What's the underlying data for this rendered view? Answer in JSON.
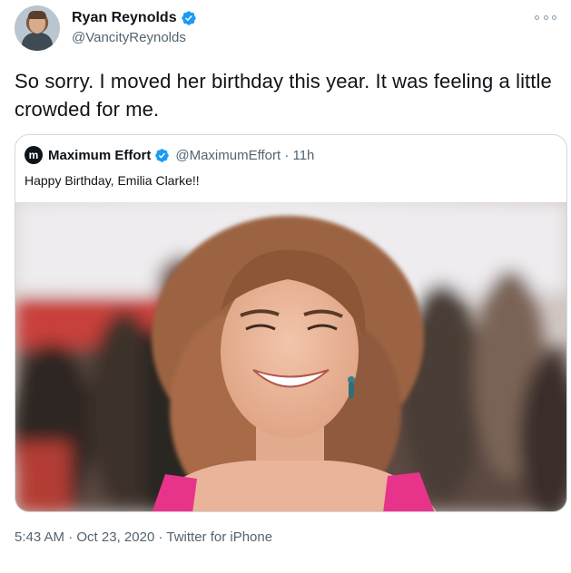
{
  "author": {
    "display_name": "Ryan Reynolds",
    "handle": "@VancityReynolds",
    "verified": true
  },
  "tweet": {
    "text": "So sorry. I moved her birthday this year. It was feeling a little crowded for me."
  },
  "quoted_tweet": {
    "logo_glyph": "m",
    "display_name": "Maximum Effort",
    "handle_and_time": "@MaximumEffort · 11h",
    "text": "Happy Birthday, Emilia Clarke!!",
    "verified": true
  },
  "meta": {
    "time": "5:43 AM",
    "date": "Oct 23, 2020",
    "source": "Twitter for iPhone"
  },
  "colors": {
    "verified_blue": "#1d9bf0",
    "text_primary": "#0f1419",
    "text_secondary": "#536471",
    "border": "#cfd9de"
  }
}
